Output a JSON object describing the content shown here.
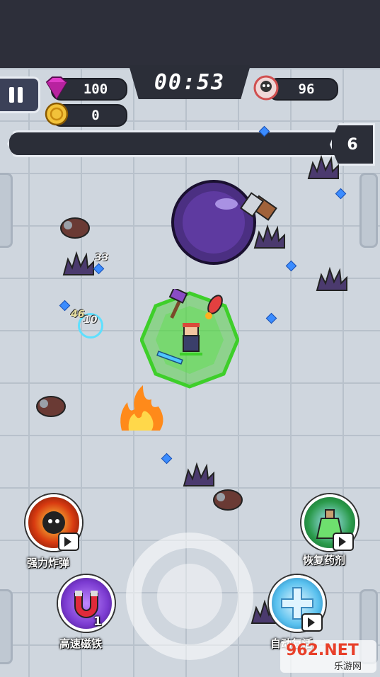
{
  "hud": {
    "timer": "00:53",
    "gems": "100",
    "coins": "0",
    "kills": "96",
    "level": "6",
    "xp_progress": 0.0
  },
  "skills": {
    "bomb_label": "强力炸弹",
    "potion_label": "恢复药剂",
    "magnet_label": "高速磁铁",
    "magnet_count": "1",
    "revive_label": "自动复活"
  },
  "damage_numbers": [
    "33",
    "46",
    "10"
  ],
  "watermark": {
    "brand": "962.NET",
    "sub": "乐游网"
  },
  "colors": {
    "gem": "#e03cc8",
    "coin": "#f2c23a",
    "aura": "#3ecf2a",
    "topbar": "#2d2f3a"
  },
  "icons": [
    "pause-icon",
    "gem-icon",
    "coin-icon",
    "skull-icon",
    "bomb-icon",
    "potion-icon",
    "magnet-icon",
    "revive-icon",
    "video-ad-icon"
  ]
}
